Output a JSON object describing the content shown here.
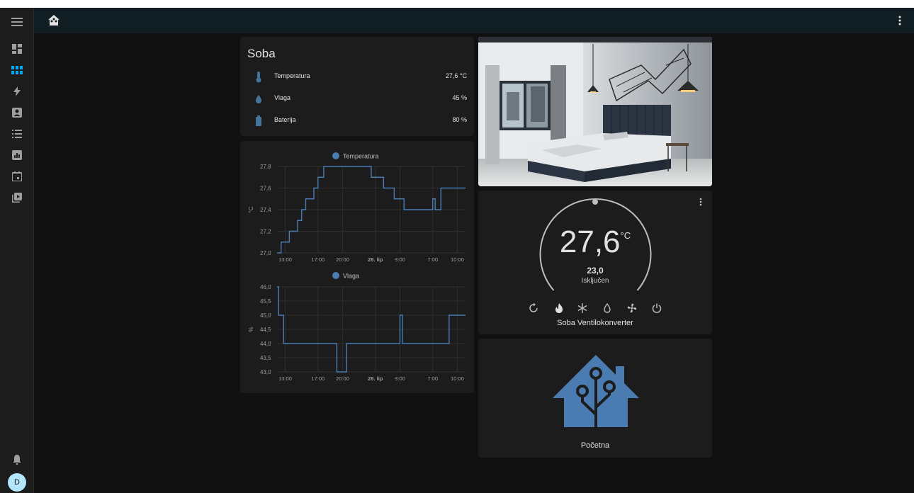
{
  "toolbar": {
    "menu_icon": "menu-icon",
    "home_icon": "home-assistant-icon",
    "more_icon": "dots-vertical-icon"
  },
  "sidebar": {
    "items": [
      {
        "icon": "view-dashboard-icon",
        "active": false
      },
      {
        "icon": "view-grid-icon",
        "active": true
      },
      {
        "icon": "lightning-bolt-icon",
        "active": false
      },
      {
        "icon": "account-box-icon",
        "active": false
      },
      {
        "icon": "format-list-icon",
        "active": false
      },
      {
        "icon": "chart-box-icon",
        "active": false
      },
      {
        "icon": "calendar-icon",
        "active": false
      },
      {
        "icon": "play-box-multiple-icon",
        "active": false
      }
    ],
    "bell_icon": "bell-icon",
    "avatar": "D"
  },
  "entities": {
    "title": "Soba",
    "rows": [
      {
        "icon": "thermometer-icon",
        "name": "Temperatura",
        "value": "27,6 °C"
      },
      {
        "icon": "water-percent-icon",
        "name": "Vlaga",
        "value": "45 %"
      },
      {
        "icon": "battery-icon",
        "name": "Baterija",
        "value": "80 %"
      }
    ]
  },
  "chart_data": [
    {
      "type": "line",
      "title": "",
      "legend": "Temperatura",
      "ylabel": "°C",
      "ylim": [
        27.0,
        27.8
      ],
      "yticks": [
        "27,0",
        "27,2",
        "27,4",
        "27,6",
        "27,8"
      ],
      "xticks": [
        "13:00",
        "17:00",
        "20:00",
        "28. lip",
        "3:00",
        "7:00",
        "10:00"
      ],
      "x_hours": [
        12.0,
        12.5,
        13.5,
        14.5,
        15.0,
        15.5,
        16.5,
        17.0,
        17.7,
        19.0,
        22.0,
        23.5,
        25.0,
        26.0,
        26.3,
        26.8,
        27.5,
        28.0,
        29.0,
        30.5,
        31.0,
        31.3,
        32.0,
        33.5,
        35.0
      ],
      "values": [
        27.0,
        27.1,
        27.2,
        27.3,
        27.4,
        27.5,
        27.6,
        27.7,
        27.8,
        27.8,
        27.8,
        27.7,
        27.6,
        27.6,
        27.5,
        27.5,
        27.4,
        27.4,
        27.4,
        27.4,
        27.5,
        27.4,
        27.6,
        27.6,
        27.6
      ]
    },
    {
      "type": "line",
      "title": "",
      "legend": "Vlaga",
      "ylabel": "%",
      "ylim": [
        43.0,
        46.0
      ],
      "yticks": [
        "43,0",
        "43,5",
        "44,0",
        "44,5",
        "45,0",
        "45,5",
        "46,0"
      ],
      "xticks": [
        "13:00",
        "17:00",
        "20:00",
        "28. lip",
        "3:00",
        "7:00",
        "10:00"
      ],
      "x_hours": [
        12.0,
        12.2,
        12.8,
        19.3,
        20.5,
        27.0,
        27.3,
        28.0,
        33.0,
        35.0
      ],
      "values": [
        46.0,
        45.0,
        44.0,
        43.0,
        44.0,
        45.0,
        44.0,
        44.0,
        45.0,
        45.0
      ]
    }
  ],
  "thermostat": {
    "current": "27,6",
    "unit": "°C",
    "target": "23,0",
    "state": "Isključen",
    "name": "Soba Ventilokonverter",
    "more_icon": "dots-vertical-icon",
    "modes": [
      "autorenew-icon",
      "fire-icon",
      "snowflake-icon",
      "water-percent-icon",
      "fan-icon",
      "power-icon"
    ]
  },
  "launcher": {
    "label": "Početna",
    "icon": "home-assistant-logo-icon"
  },
  "colors": {
    "accent": "#03a9f4",
    "series": "#4a7bb1",
    "logo": "#41bdf5"
  }
}
